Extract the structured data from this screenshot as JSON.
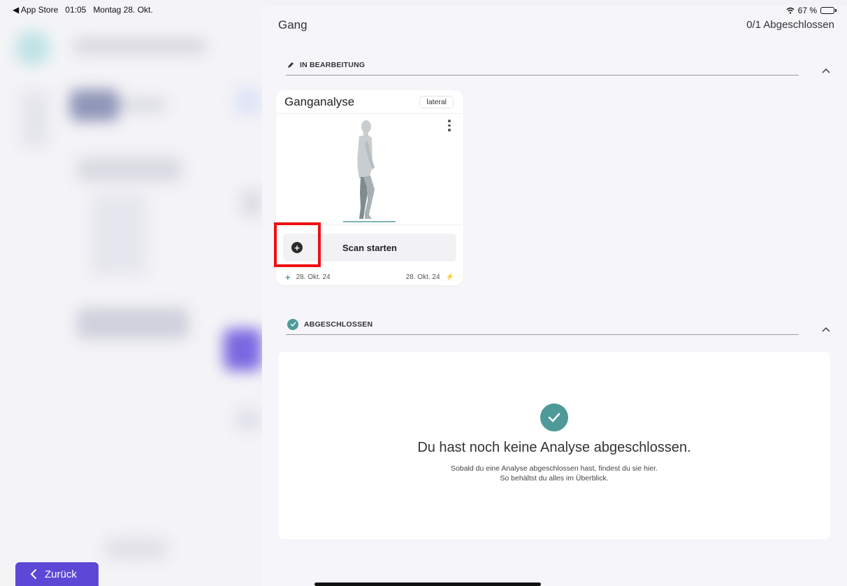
{
  "status_bar": {
    "back_app": "◀ App Store",
    "time": "01:05",
    "date": "Montag 28. Okt.",
    "wifi_icon": "wifi-icon",
    "battery": "67 %",
    "battery_level": 0.67
  },
  "header": {
    "title": "Gang",
    "progress": "0/1 Abgeschlossen"
  },
  "sections": {
    "in_progress": {
      "label": "IN BEARBEITUNG",
      "icon": "pencil-icon"
    },
    "completed": {
      "label": "ABGESCHLOSSEN",
      "icon": "check-circle-icon"
    }
  },
  "analysis_card": {
    "title": "Ganganalyse",
    "badge": "lateral",
    "scan_button": "Scan starten",
    "created_date": "28. Okt. 24",
    "updated_date": "28. Okt. 24"
  },
  "empty_state": {
    "title": "Du hast noch keine Analyse abgeschlossen.",
    "line1": "Sobald du eine Analyse abgeschlossen hast, findest du sie hier.",
    "line2": "So behältst du alles im Überblick."
  },
  "back_button": {
    "label": "Zurück"
  },
  "colors": {
    "accent": "#5b48d6",
    "teal": "#4f9a99",
    "highlight": "#e11111"
  }
}
